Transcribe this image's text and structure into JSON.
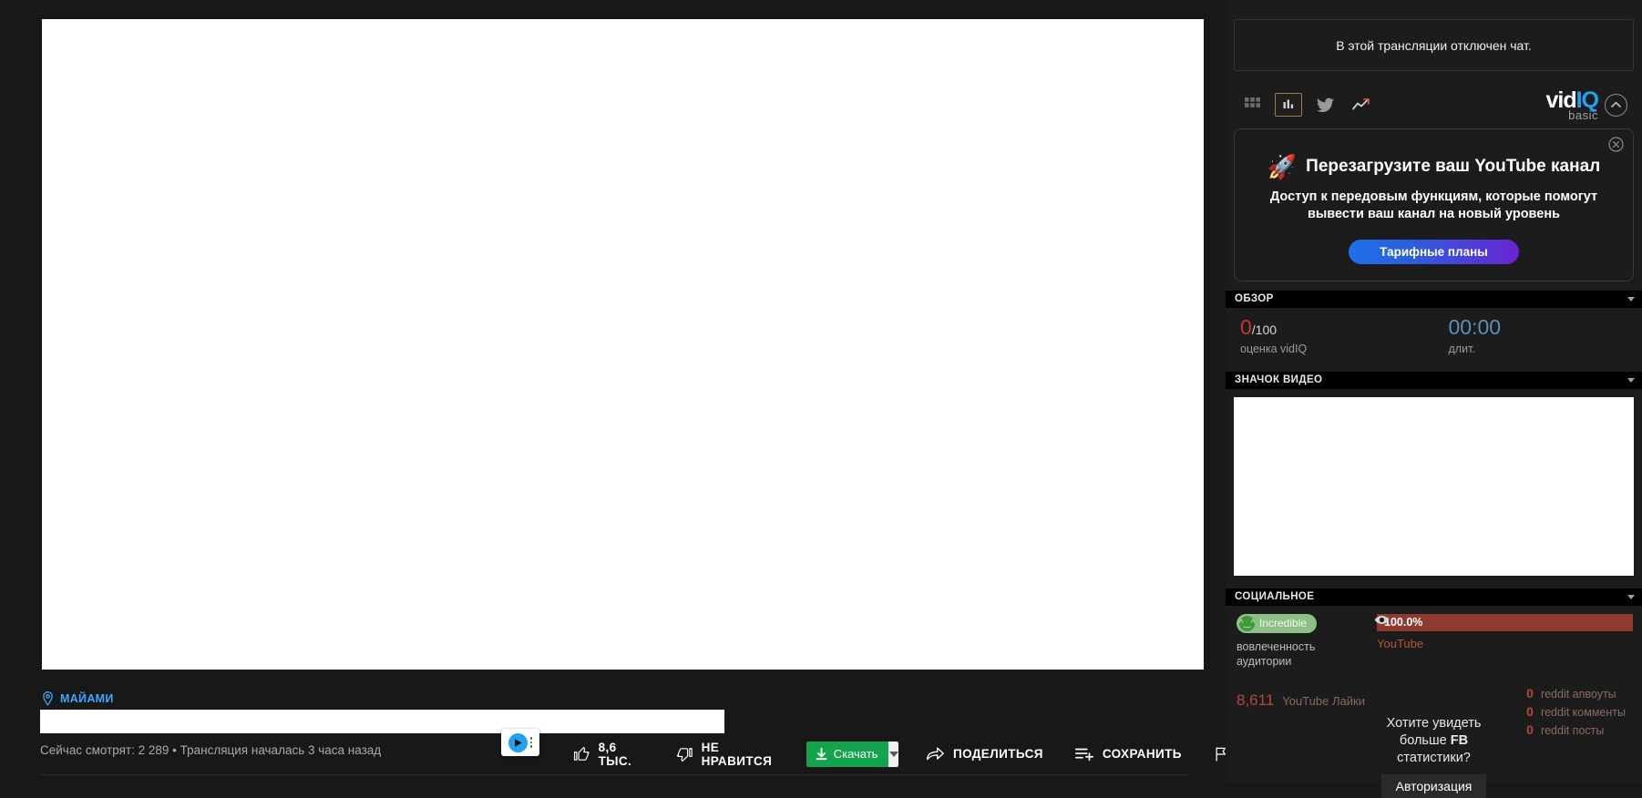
{
  "video": {
    "geo_label": "МАЙАМИ",
    "meta": "Сейчас смотрят: 2 289 • Трансляция началась 3 часа назад",
    "actions": {
      "like_count": "8,6 ТЫС.",
      "dislike_label": "НЕ НРАВИТСЯ",
      "download_label": "Скачать",
      "share_label": "ПОДЕЛИТЬСЯ",
      "save_label": "СОХРАНИТЬ"
    }
  },
  "sidebar": {
    "chat_disabled": "В этой трансляции отключен чат.",
    "logo": {
      "word1": "vid",
      "word2": "IQ",
      "tier": "basic"
    },
    "promo": {
      "rocket": "🚀",
      "title": "Перезагрузите ваш YouTube канал",
      "body": "Доступ к передовым функциям, которые помогут вывести ваш канал на новый уровень",
      "cta": "Тарифные планы"
    },
    "sections": {
      "overview": "ОБЗОР",
      "thumbnail": "ЗНАЧОК ВИДЕО",
      "social": "СОЦИАЛЬНОЕ"
    },
    "overview": {
      "score_value": "0",
      "score_suffix": "/100",
      "score_label": "оценка vidIQ",
      "duration_value": "00:00",
      "duration_label": "длит."
    },
    "social": {
      "engagement_pill": "Incredible",
      "engagement_face": "^‿^",
      "engagement_caption": "вовлеченность аудитории",
      "bar_value": "100.0%",
      "bar_source": "YouTube",
      "likes_value": "8,611",
      "likes_label": "YouTube Лайки",
      "reddit": [
        {
          "value": "0",
          "label": "reddit апвоуты"
        },
        {
          "value": "0",
          "label": "reddit комменты"
        },
        {
          "value": "0",
          "label": "reddit посты"
        }
      ],
      "fb_question_1": "Хотите увидеть больше ",
      "fb_question_bold": "FB",
      "fb_question_2": " статистики?",
      "fb_auth_button": "Авторизация"
    }
  },
  "colors": {
    "accent_blue": "#3ea6ff",
    "vidiq_blue": "#1fa2f0",
    "download_green": "#14a44d",
    "score_red": "#c0392b",
    "bar_red": "#8e3a2e",
    "pill_green": "#8cc084"
  }
}
